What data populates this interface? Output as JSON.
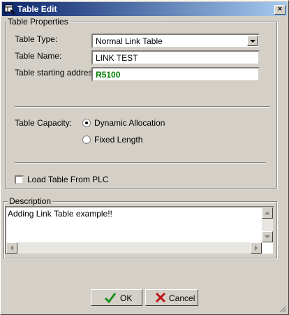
{
  "window": {
    "title": "Table Edit",
    "close_symbol": "×"
  },
  "properties": {
    "group_label": "Table Properties",
    "table_type_label": "Table Type:",
    "table_type_value": "Normal Link Table",
    "table_name_label": "Table Name:",
    "table_name_value": "LINK TEST",
    "start_address_label": "Table starting address:",
    "start_address_value": "R5100",
    "capacity_label": "Table Capacity:",
    "dynamic_label": "Dynamic Allocation",
    "dynamic_selected": true,
    "fixed_label": "Fixed Length",
    "load_label": "Load Table From PLC",
    "load_checked": false
  },
  "description": {
    "group_label": "Description",
    "text": "Adding Link Table example!!"
  },
  "buttons": {
    "ok_label": "OK",
    "cancel_label": "Cancel"
  },
  "colors": {
    "title_start": "#0a246a",
    "title_end": "#a6caf0",
    "address_text": "#008000",
    "ok_check": "#1a8f1a",
    "cancel_x": "#c0141a"
  }
}
